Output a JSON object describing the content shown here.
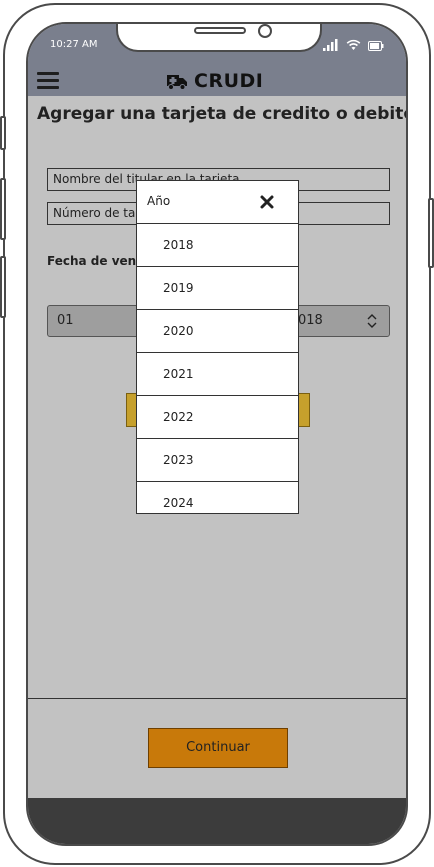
{
  "status_bar": {
    "time": "10:27 AM"
  },
  "header": {
    "app_name": "CRUDI",
    "brand_icon": "ambulance-icon"
  },
  "page": {
    "title": "Agregar una tarjeta de credito o debito"
  },
  "form": {
    "cardholder_placeholder": "Nombre del titular en la tarjeta",
    "card_number_placeholder": "Número de ta",
    "expiry_label": "Fecha de venc",
    "month_value": "01",
    "year_value_partial": "018"
  },
  "picker": {
    "title": "Año",
    "options": [
      "2018",
      "2019",
      "2020",
      "2021",
      "2022",
      "2023",
      "2024"
    ]
  },
  "footer": {
    "continue_label": "Continuar"
  },
  "colors": {
    "header": "#7a7f8d",
    "background": "#c2c2c2",
    "gold_button": "#c6a02c",
    "continue_button": "#c8790a",
    "bottom_bar": "#3c3c3c"
  }
}
